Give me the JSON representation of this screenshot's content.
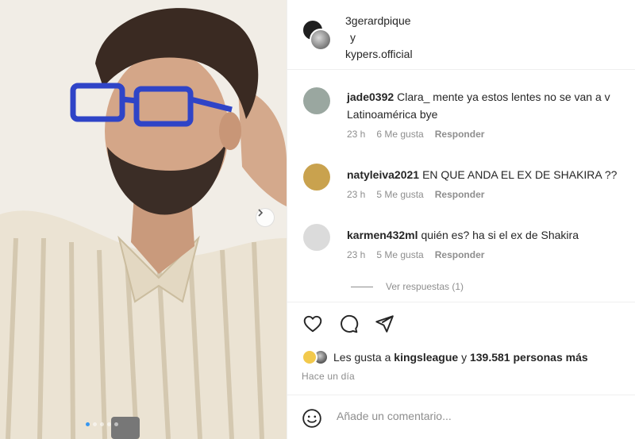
{
  "header": {
    "user1": "3gerardpique",
    "conjunction": "y",
    "user2": "kypers.official"
  },
  "comments": [
    {
      "user": "jade0392",
      "text": "Clara_ mente ya estos lentes no se van a v",
      "text2": "Latinoamérica bye",
      "time": "23 h",
      "likes": "6 Me gusta",
      "reply": "Responder",
      "avatar_color": "#9aa7a0"
    },
    {
      "user": "natyleiva2021",
      "text": "EN QUE ANDA EL EX DE SHAKIRA ??",
      "time": "23 h",
      "likes": "5 Me gusta",
      "reply": "Responder",
      "avatar_color": "#c9a24e"
    },
    {
      "user": "karmen432ml",
      "text": "quién es? ha si el ex de Shakira",
      "time": "23 h",
      "likes": "5 Me gusta",
      "reply": "Responder",
      "avatar_color": "#dbdbdb"
    }
  ],
  "view_replies": "Ver respuestas (1)",
  "actions": {
    "like_icon": "heart-icon",
    "comment_icon": "comment-icon",
    "share_icon": "send-icon"
  },
  "likes": {
    "prefix": "Les gusta a",
    "user": "kingsleague",
    "mid": "y",
    "count": "139.581 personas más"
  },
  "time_ago": "Hace un día",
  "add_comment": {
    "placeholder": "Añade un comentario...",
    "emoji_icon": "smile-icon"
  },
  "carousel": {
    "dot_count": 5,
    "active_index": 0,
    "active_color": "#3897f0"
  },
  "colors": {
    "text": "#262626",
    "muted": "#8e8e8e",
    "border": "#efefef",
    "glasses": "#2f44c7"
  }
}
